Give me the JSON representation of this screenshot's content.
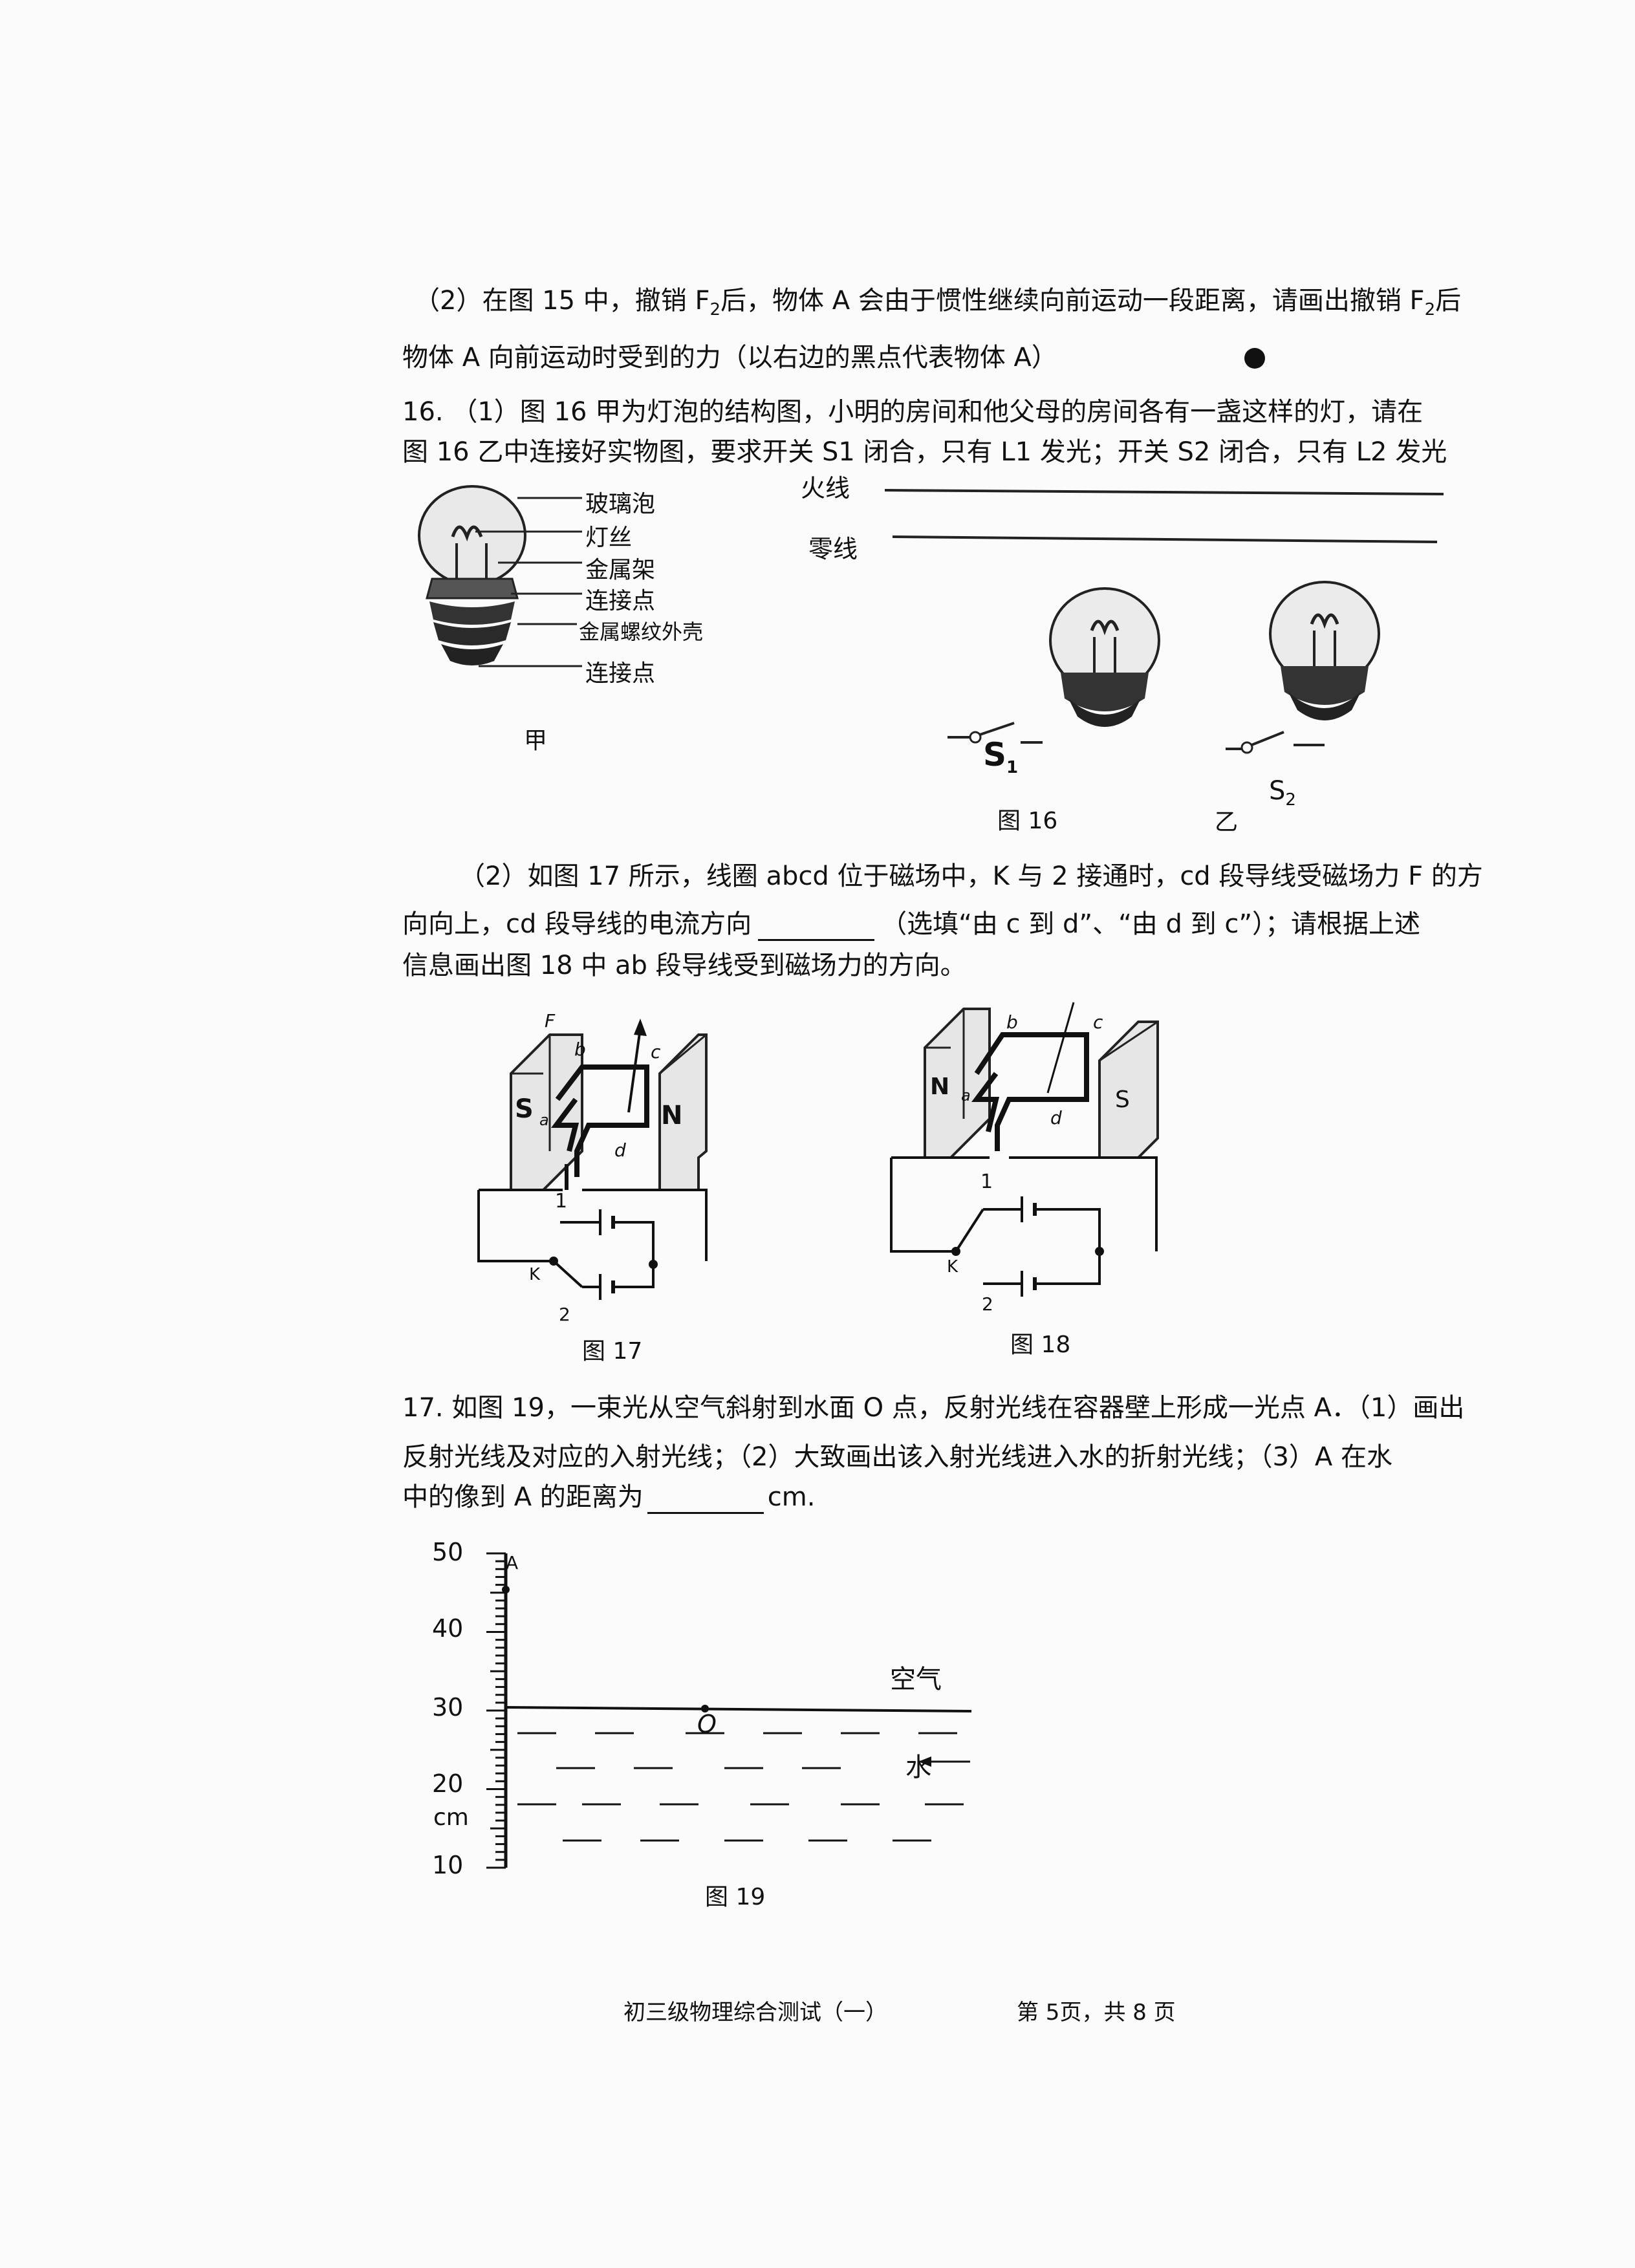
{
  "q15_part2": {
    "line1_a": "（2）在图 15 中，撤销 F",
    "line1_sub": "2",
    "line1_b": "后，物体 A 会由于惯性继续向前运动一段距离，请画出撤销 F",
    "line1_sub2": "2",
    "line1_c": "后",
    "line2": "物体 A 向前运动时受到的力（以右边的黑点代表物体 A）"
  },
  "q16": {
    "part1_line1": "16. （1）图 16 甲为灯泡的结构图，小明的房间和他父母的房间各有一盏这样的灯，请在",
    "part1_line2": "图 16 乙中连接好实物图，要求开关 S1 闭合，只有 L1 发光；开关 S2 闭合，只有 L2 发光",
    "bulb_labels": [
      "玻璃泡",
      "灯丝",
      "金属架",
      "连接点",
      "金属螺纹外壳",
      "连接点"
    ],
    "label_jia": "甲",
    "live_wire": "火线",
    "neutral_wire": "零线",
    "switch1": "S",
    "switch1_sub": "1",
    "switch2": "S",
    "switch2_sub": "2",
    "label_yi": "乙",
    "fig_caption": "图 16",
    "part2_line1": "（2）如图 17 所示，线圈 abcd 位于磁场中，K 与 2 接通时，cd 段导线受磁场力 F 的方",
    "part2_line2_a": "向向上，cd 段导线的电流方向",
    "part2_line2_b": "（选填“由 c 到 d”、“由 d 到 c”）；请根据上述",
    "part2_line3": "信息画出图 18 中 ab 段导线受到磁场力的方向。"
  },
  "fig17": {
    "caption": "图 17",
    "force": "F",
    "pole_left": "S",
    "pole_right": "N",
    "a": "a",
    "b": "b",
    "c": "c",
    "d": "d",
    "k": "K",
    "one": "1",
    "two": "2"
  },
  "fig18": {
    "caption": "图 18",
    "pole_left": "N",
    "pole_right": "S",
    "a": "a",
    "b": "b",
    "c": "c",
    "d": "d",
    "k": "K",
    "one": "1",
    "two": "2"
  },
  "q17": {
    "line1": "17. 如图 19，一束光从空气斜射到水面 O 点，反射光线在容器壁上形成一光点 A．（1）画出",
    "line2": "反射光线及对应的入射光线；（2）大致画出该入射光线进入水的折射光线；（3）A 在水",
    "line3_a": "中的像到 A 的距离为",
    "line3_b": "cm."
  },
  "fig19": {
    "ticks": [
      "50",
      "40",
      "30",
      "20",
      "10"
    ],
    "unit": "cm",
    "point_a": "A",
    "point_o": "O",
    "air": "空气",
    "water": "水",
    "caption": "图 19"
  },
  "footer": {
    "title": "初三级物理综合测试（一）",
    "page": "第 5页，共 8 页"
  }
}
